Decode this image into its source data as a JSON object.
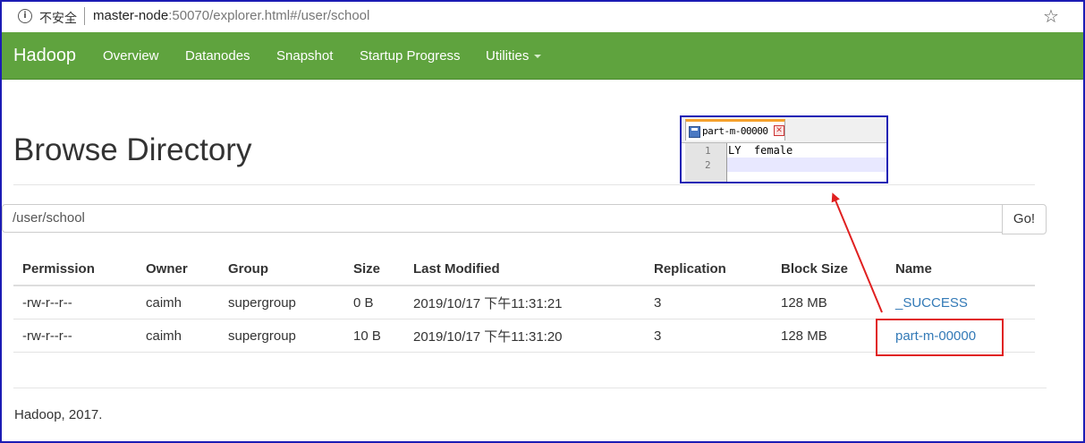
{
  "browser": {
    "security_label": "不安全",
    "url_host": "master-node",
    "url_path": ":50070/explorer.html#/user/school"
  },
  "navbar": {
    "brand": "Hadoop",
    "items": [
      {
        "label": "Overview"
      },
      {
        "label": "Datanodes"
      },
      {
        "label": "Snapshot"
      },
      {
        "label": "Startup Progress"
      },
      {
        "label": "Utilities"
      }
    ]
  },
  "page": {
    "title": "Browse Directory",
    "path_value": "/user/school",
    "go_label": "Go!"
  },
  "table": {
    "headers": [
      "Permission",
      "Owner",
      "Group",
      "Size",
      "Last Modified",
      "Replication",
      "Block Size",
      "Name"
    ],
    "rows": [
      [
        "-rw-r--r--",
        "caimh",
        "supergroup",
        "0 B",
        "2019/10/17 下午11:31:21",
        "3",
        "128 MB",
        "_SUCCESS"
      ],
      [
        "-rw-r--r--",
        "caimh",
        "supergroup",
        "10 B",
        "2019/10/17 下午11:31:20",
        "3",
        "128 MB",
        "part-m-00000"
      ]
    ]
  },
  "footer": "Hadoop, 2017.",
  "popup": {
    "tab_title": "part-m-00000",
    "lines": [
      {
        "number": "1",
        "text": "LY  female"
      },
      {
        "number": "2",
        "text": ""
      }
    ]
  },
  "colors": {
    "navbar": "#5fa33e",
    "link": "#337ab7",
    "annotation_red": "#e02020",
    "annotation_blue": "#1c1cb4"
  },
  "icons": [
    "info-icon",
    "star-icon",
    "caret-down-icon",
    "save-icon",
    "tab-close-icon",
    "arrow-annotation"
  ]
}
